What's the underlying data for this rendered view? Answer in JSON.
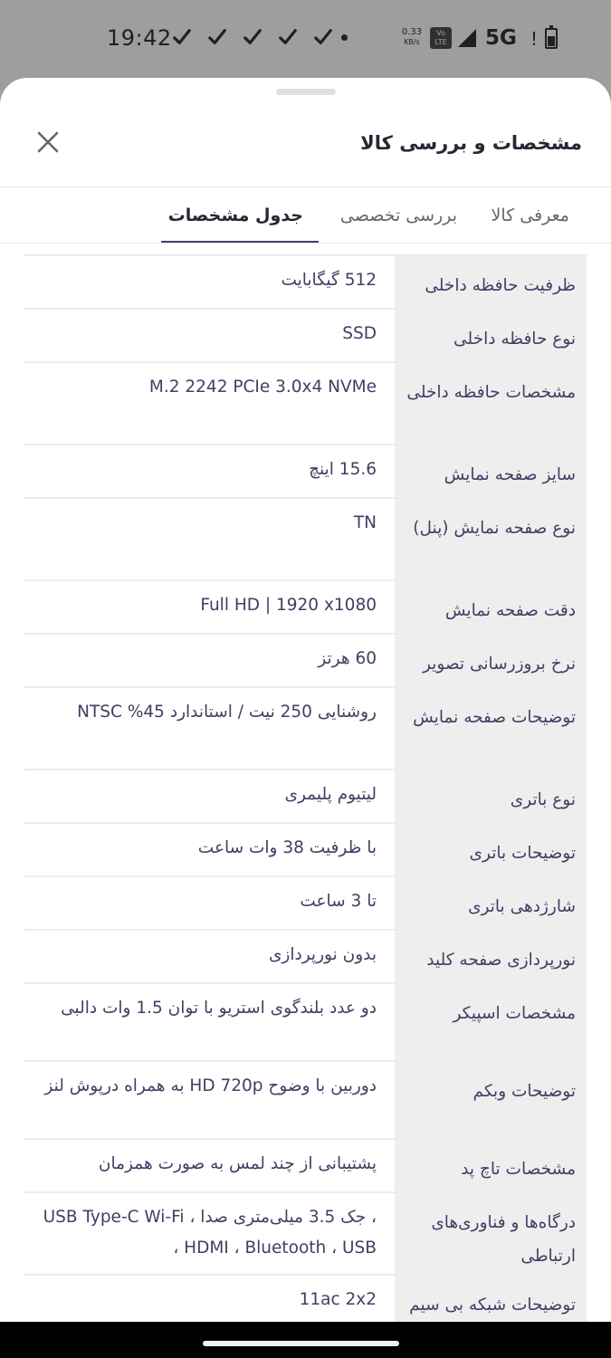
{
  "status_bar": {
    "time": "19:42",
    "speed": "0.33",
    "speed_unit": "KB/s",
    "volte": "Vo LTE",
    "network": "5G",
    "alert": "!",
    "icons": [
      "tick-icon",
      "tick-icon",
      "tick-icon",
      "tick-icon",
      "tick-icon",
      "dot-icon",
      "signal-icon",
      "battery-icon"
    ]
  },
  "sheet": {
    "title": "مشخصات و بررسی کالا",
    "close_icon": "close-icon"
  },
  "tabs": [
    {
      "label": "معرفی کالا",
      "active": false
    },
    {
      "label": "بررسی تخصصی",
      "active": false
    },
    {
      "label": "جدول مشخصات",
      "active": true
    }
  ],
  "specs": [
    {
      "label": "ظرفیت حافظه داخلی",
      "value": "512 گیگابایت"
    },
    {
      "label": "نوع حافظه داخلی",
      "value": "SSD"
    },
    {
      "label": "مشخصات حافظه داخلی",
      "value": "M.2 2242 PCIe 3.0x4 NVMe"
    },
    {
      "label": "سایز صفحه نمایش",
      "value": "15.6 اینچ"
    },
    {
      "label": "نوع صفحه نمایش (پنل)",
      "value": "TN"
    },
    {
      "label": "دقت صفحه نمایش",
      "value": "Full HD | 1920 x1080"
    },
    {
      "label": "نرخ بروزرسانی تصویر",
      "value": "60 هرتز"
    },
    {
      "label": "توضیحات صفحه نمایش",
      "value": "روشنایی 250 نیت / استاندارد 45% NTSC"
    },
    {
      "label": "نوع باتری",
      "value": "لیتیوم پلیمری"
    },
    {
      "label": "توضیحات باتری",
      "value": "با ظرفیت 38 وات ساعت"
    },
    {
      "label": "شارژدهی باتری",
      "value": "تا 3 ساعت"
    },
    {
      "label": "نورپردازی صفحه کلید",
      "value": "بدون نورپردازی"
    },
    {
      "label": "مشخصات اسپیکر",
      "value": "دو عدد بلندگوی استریو با توان 1.5 وات دالبی"
    },
    {
      "label": "توضیحات وبکم",
      "value": "دوربین با وضوح HD 720p به همراه درپوش لنز"
    },
    {
      "label": "مشخصات تاچ پد",
      "value": "پشتیبانی از چند لمس به صورت همزمان"
    },
    {
      "label": "درگاه‌ها و فناوری‌های ارتباطی",
      "value": "، جک 3.5 میلی‌متری صدا ، USB Type-C Wi-Fi ، HDMI ، Bluetooth ، USB"
    },
    {
      "label": "توضیحات شبکه بی سیم Wi-Fi",
      "value": "11ac 2x2"
    }
  ],
  "colors": {
    "sheet_bg": "#ffffff",
    "label_col_bg": "#eeeeef",
    "text": "#3f4064",
    "scrim": "#9e9e9e"
  }
}
